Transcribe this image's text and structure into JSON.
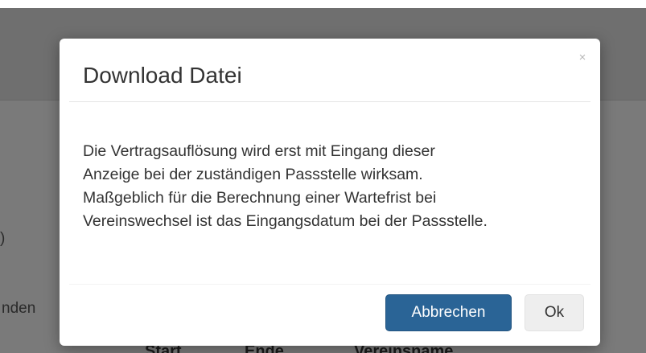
{
  "dialog": {
    "title": "Download Datei",
    "close_glyph": "×",
    "body_lines": [
      "Die Vertragsauflösung wird erst mit Eingang dieser",
      "Anzeige bei der zuständigen Passstelle wirksam.",
      "Maßgeblich für die Berechnung einer Wartefrist bei",
      "Vereinswechsel ist das Eingangsdatum bei der Passstelle."
    ],
    "cancel_label": "Abbrechen",
    "ok_label": "Ok"
  },
  "background": {
    "partial_text_1": ")",
    "partial_text_2": "nden",
    "table_headers": [
      "Start",
      "Ende",
      "Vereinsname"
    ]
  },
  "colors": {
    "primary_button": "#2a6496",
    "default_button": "#eeeeee",
    "backdrop": "#7a7a7a"
  }
}
